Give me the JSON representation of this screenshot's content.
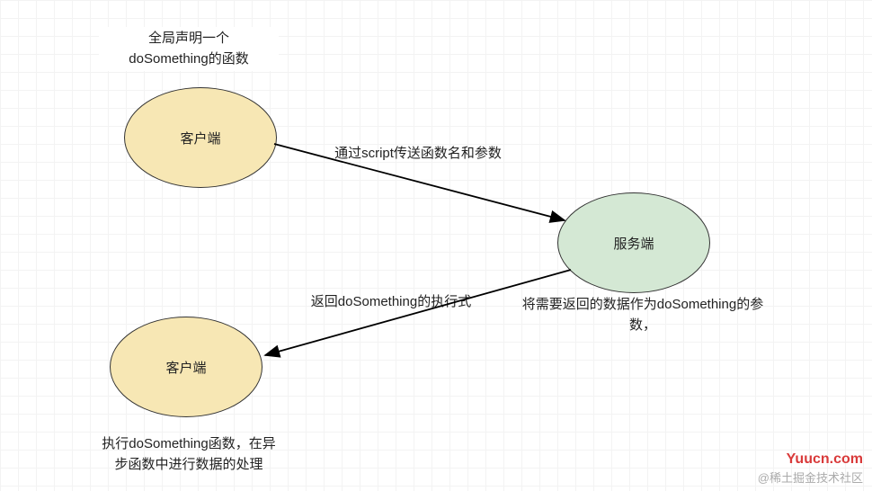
{
  "nodes": {
    "client1": "客户端",
    "client2": "客户端",
    "server": "服务端"
  },
  "annotations": {
    "topNote": "全局声明一个\ndoSomething的函数",
    "arrow1": "通过script传送函数名和参数",
    "arrow2": "返回doSomething的执行式",
    "serverNote": "将需要返回的数据作为doSomething的参\n数，",
    "bottomNote": "执行doSomething函数，在异\n步函数中进行数据的处理"
  },
  "watermark": {
    "site": "Yuucn.com",
    "community": "@稀土掘金技术社区"
  }
}
